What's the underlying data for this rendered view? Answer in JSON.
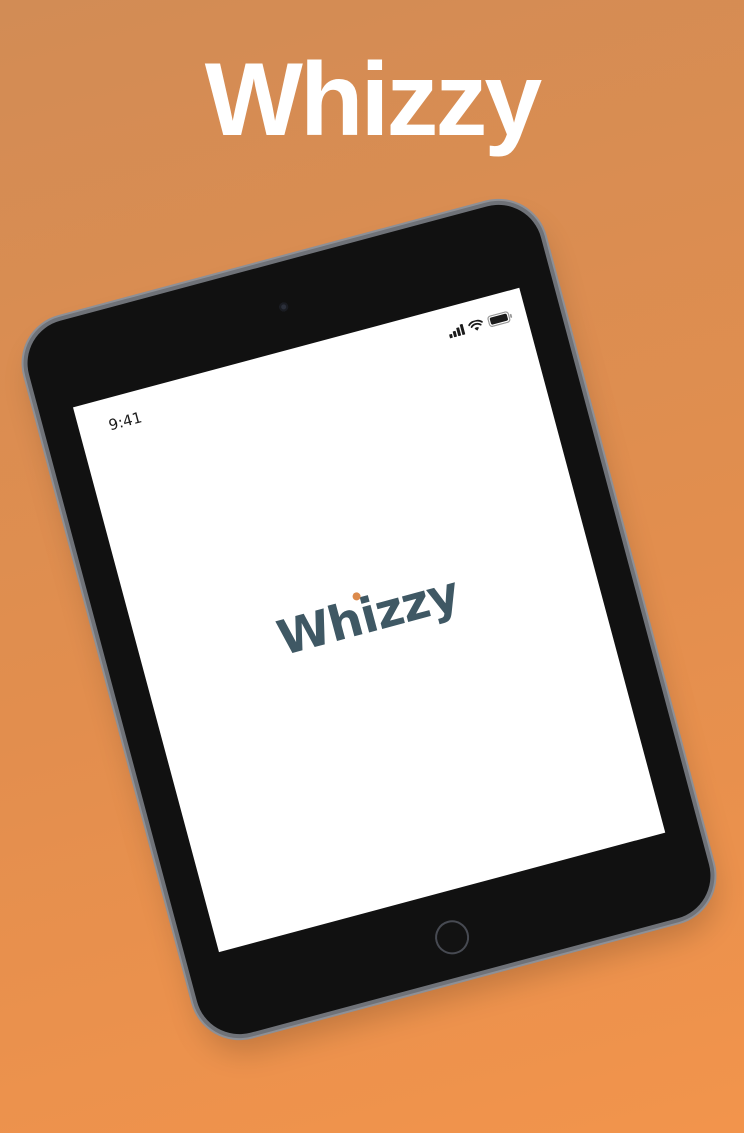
{
  "page": {
    "headline": "Whizzy"
  },
  "device": {
    "status_bar": {
      "time": "9:41",
      "signal_icon": "cellular-signal-icon",
      "wifi_icon": "wifi-icon",
      "battery_icon": "battery-icon"
    },
    "screen": {
      "logo_text": "Whizzy",
      "logo_dot_color": "#dc8a4b",
      "logo_color": "#3f5864"
    }
  },
  "colors": {
    "background_top": "#d28c55",
    "background_bottom": "#f2944c",
    "headline": "#ffffff",
    "bezel": "#111111"
  }
}
